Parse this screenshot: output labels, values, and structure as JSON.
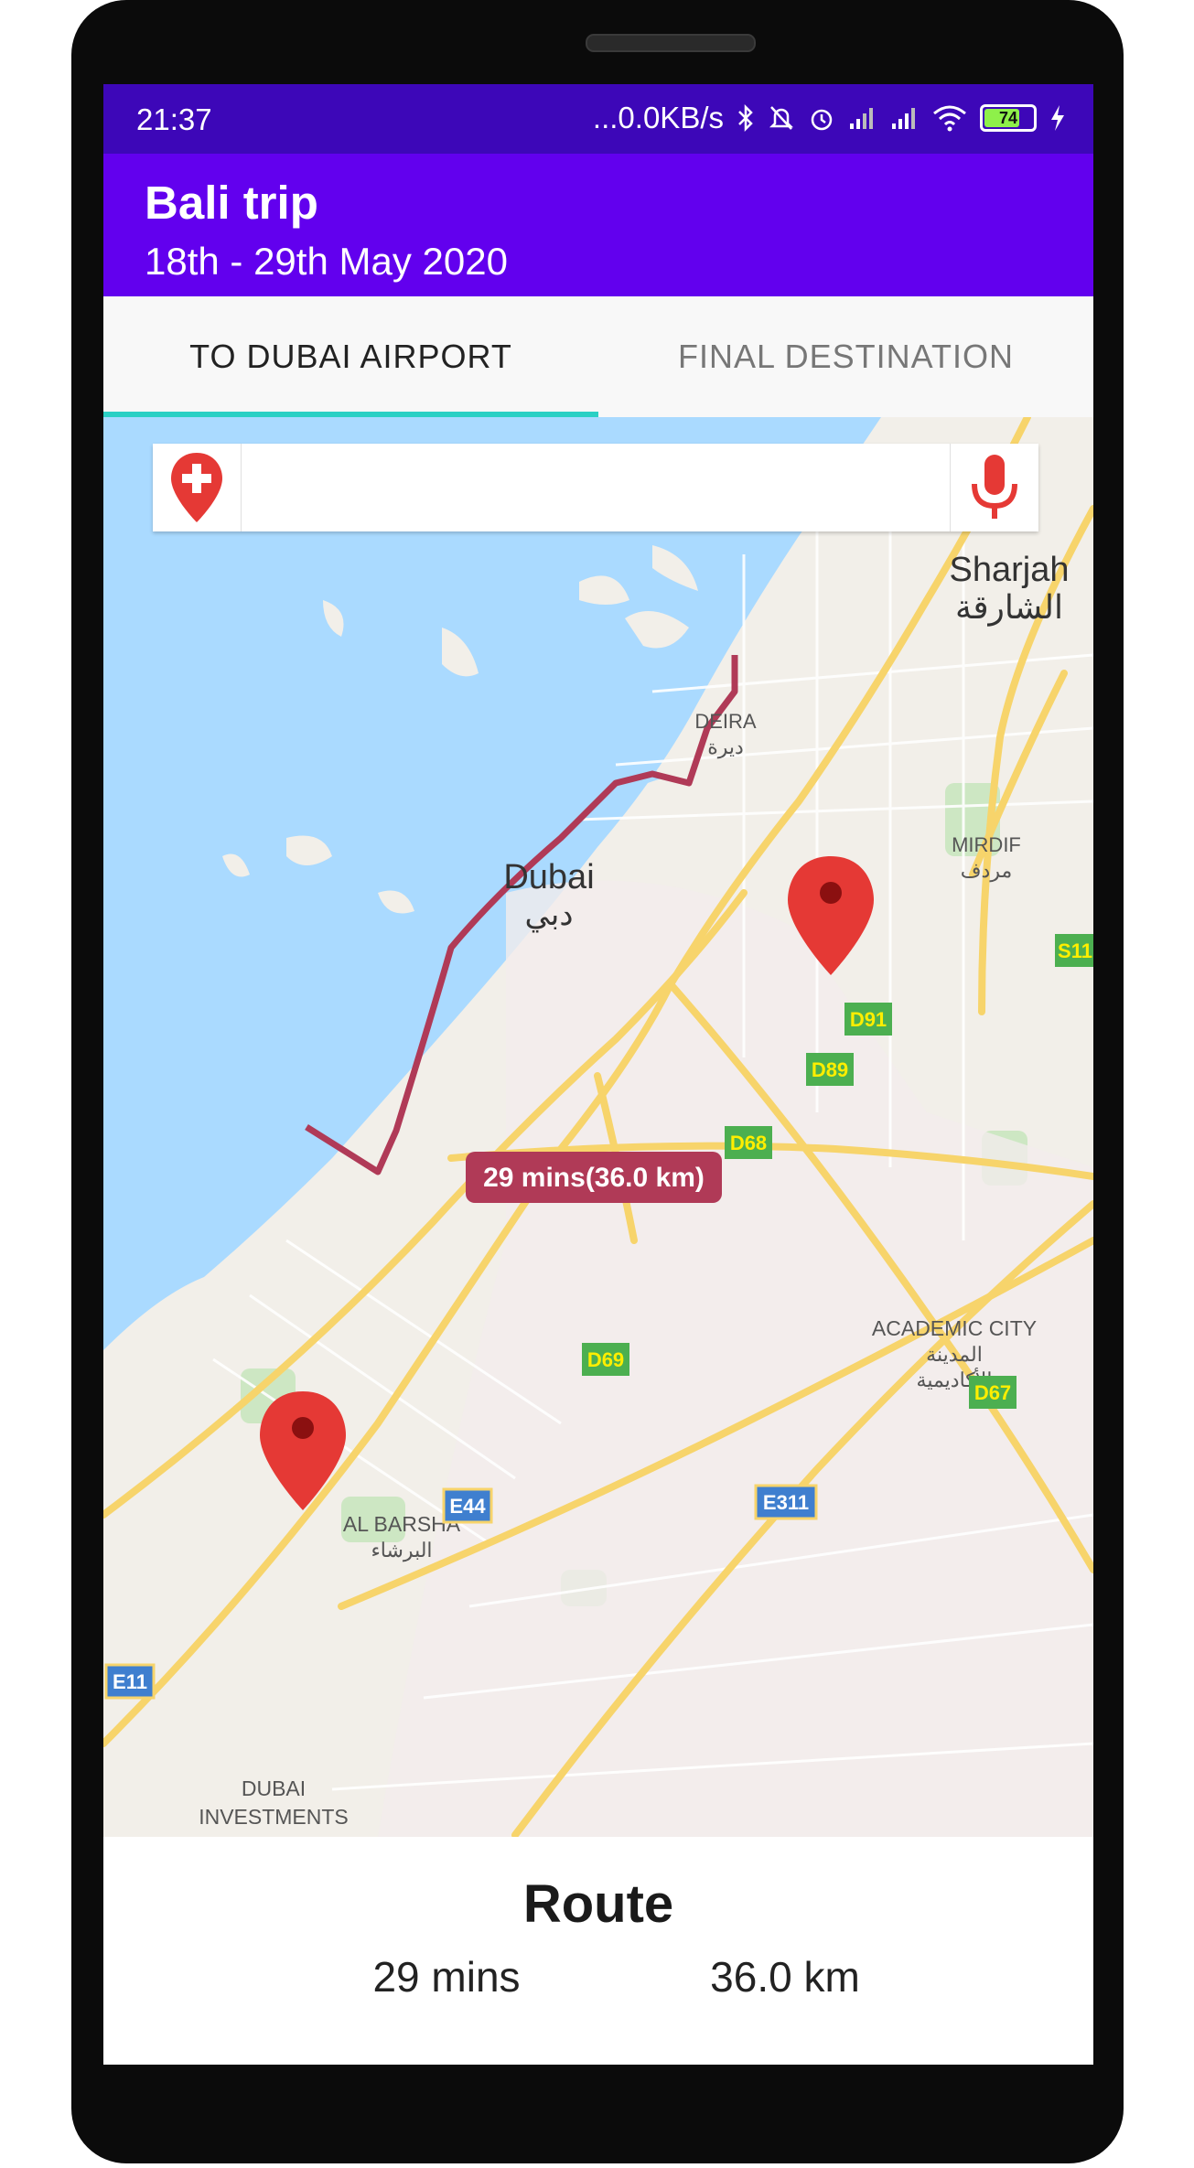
{
  "status_bar": {
    "time": "21:37",
    "network_speed": "...0.0KB/s",
    "battery_level": "74",
    "icons": [
      "bluetooth-icon",
      "mute-icon",
      "alarm-icon",
      "signal-icon",
      "signal-icon",
      "wifi-icon",
      "battery-icon",
      "charging-icon"
    ]
  },
  "app_bar": {
    "title": "Bali trip",
    "subtitle": "18th - 29th May 2020"
  },
  "tabs": [
    {
      "label": "TO DUBAI AIRPORT",
      "active": true
    },
    {
      "label": "FINAL DESTINATION",
      "active": false
    }
  ],
  "search": {
    "value": "",
    "placeholder": "",
    "pin_icon": "add-location-icon",
    "mic_icon": "microphone-icon"
  },
  "map": {
    "places": {
      "sharjah": "Sharjah",
      "sharjah_ar": "الشارقة",
      "deira": "DEIRA",
      "deira_ar": "ديرة",
      "dubai": "Dubai",
      "dubai_ar": "دبي",
      "mirdif": "MIRDIF",
      "mirdif_ar": "مردف",
      "academic_city": "ACADEMIC CITY",
      "academic_city_ar1": "المدينة",
      "academic_city_ar2": "الأكاديمية",
      "al_barsha": "AL BARSHA",
      "al_barsha_ar": "البرشاء",
      "dubai_investments_1": "DUBAI",
      "dubai_investments_2": "INVESTMENTS"
    },
    "road_shields": {
      "d91": "D91",
      "d89": "D89",
      "d68": "D68",
      "d69": "D69",
      "d67": "D67",
      "s11": "S11",
      "e44": "E44",
      "e311": "E311",
      "e11": "E11"
    },
    "route_label": "29 mins(36.0 km)",
    "colors": {
      "water": "#aadaff",
      "land": "#f2efe9",
      "road": "#f7d46b",
      "route": "#b03a57",
      "marker": "#e53935"
    }
  },
  "route_summary": {
    "title": "Route",
    "duration": "29 mins",
    "distance": "36.0 km"
  }
}
